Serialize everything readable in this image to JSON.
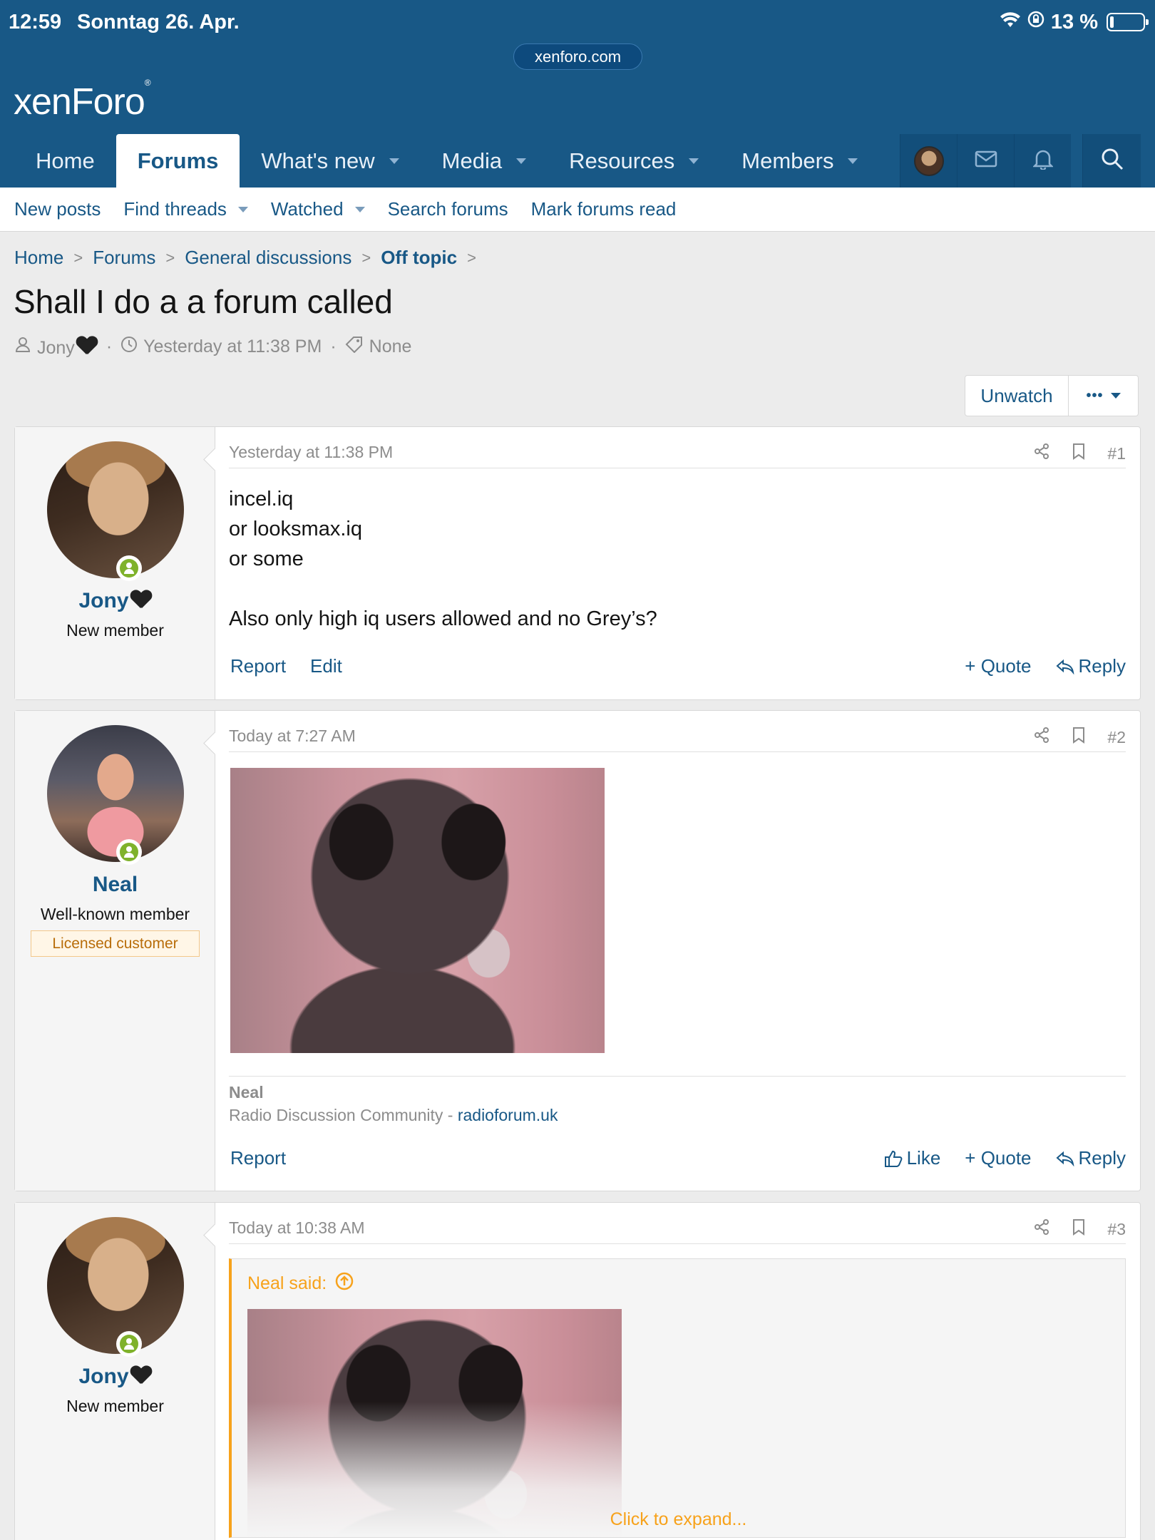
{
  "status_bar": {
    "time": "12:59",
    "date": "Sonntag 26. Apr.",
    "battery": "13 %"
  },
  "browser": {
    "url": "xenforo.com"
  },
  "site": {
    "logo": "xenForo"
  },
  "nav": {
    "tabs": [
      {
        "label": "Home"
      },
      {
        "label": "Forums"
      },
      {
        "label": "What's new"
      },
      {
        "label": "Media"
      },
      {
        "label": "Resources"
      },
      {
        "label": "Members"
      }
    ]
  },
  "subnav": {
    "items": [
      "New posts",
      "Find threads",
      "Watched",
      "Search forums",
      "Mark forums read"
    ]
  },
  "breadcrumb": [
    "Home",
    "Forums",
    "General discussions",
    "Off topic"
  ],
  "thread": {
    "title": "Shall I do a a forum called",
    "author": "Jony",
    "date": "Yesterday at 11:38 PM",
    "tags": "None",
    "unwatch": "Unwatch",
    "more": "•••"
  },
  "posts": [
    {
      "user": "Jony",
      "user_title": "New member",
      "date": "Yesterday at 11:38 PM",
      "number": "#1",
      "lines": [
        "incel.iq",
        "or looksmax.iq",
        "or some",
        "",
        "Also only high iq users allowed and no Grey’s?"
      ],
      "actions_left": [
        "Report",
        "Edit"
      ],
      "actions_right": [
        "+ Quote",
        "Reply"
      ]
    },
    {
      "user": "Neal",
      "user_title": "Well-known member",
      "banner": "Licensed customer",
      "date": "Today at 7:27 AM",
      "number": "#2",
      "signature_name": "Neal",
      "signature_text": "Radio Discussion Community - ",
      "signature_link": "radioforum.uk",
      "actions_left": [
        "Report"
      ],
      "actions_right": [
        "Like",
        "+ Quote",
        "Reply"
      ]
    },
    {
      "user": "Jony",
      "user_title": "New member",
      "date": "Today at 10:38 AM",
      "number": "#3",
      "quote_header": "Neal said:",
      "expand": "Click to expand..."
    }
  ],
  "colors": {
    "header": "#185886",
    "link": "#185886",
    "quote_accent": "#f7a21b",
    "online": "#7fb22b"
  },
  "icons": [
    "wifi-icon",
    "lock-rotation-icon",
    "battery-icon",
    "user-icon",
    "clock-icon",
    "tag-icon",
    "share-icon",
    "bookmark-icon",
    "thumbs-up-icon",
    "reply-icon",
    "envelope-icon",
    "bell-icon",
    "search-icon",
    "arrow-up-circle-icon"
  ]
}
